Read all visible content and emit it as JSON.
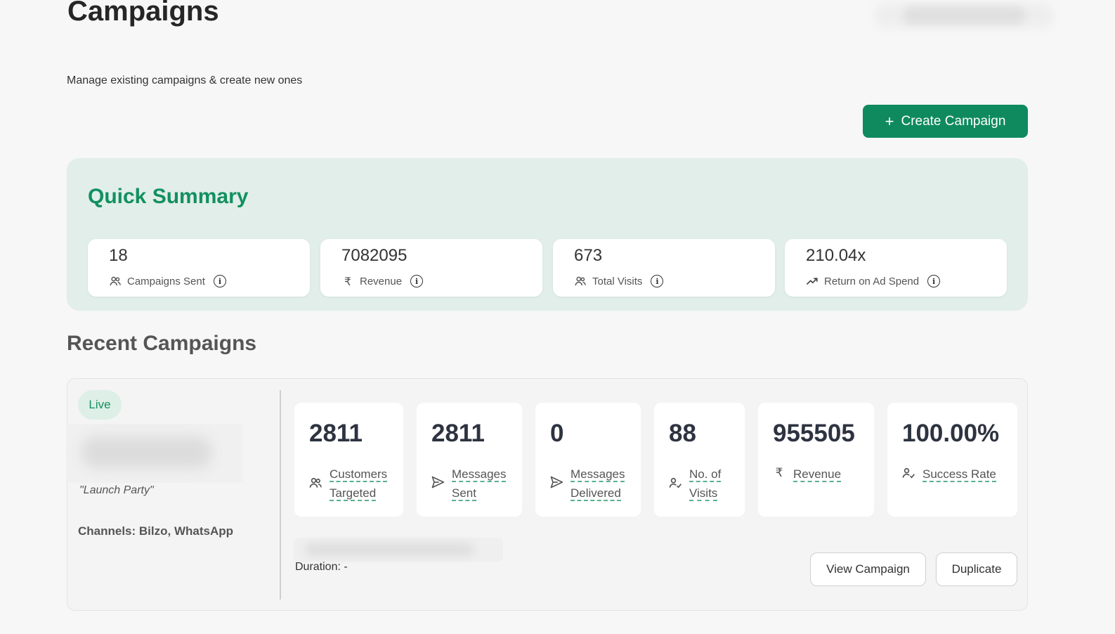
{
  "header": {
    "title": "Campaigns",
    "subtitle": "Manage existing campaigns & create new ones",
    "create_button_label": "Create Campaign"
  },
  "summary": {
    "title": "Quick Summary",
    "stats": [
      {
        "value": "18",
        "label": "Campaigns Sent",
        "icon": "users-icon"
      },
      {
        "value": "7082095",
        "label": "Revenue",
        "icon": "rupee-icon"
      },
      {
        "value": "673",
        "label": "Total Visits",
        "icon": "users-icon"
      },
      {
        "value": "210.04x",
        "label": "Return on Ad Spend",
        "icon": "trending-up-icon"
      }
    ]
  },
  "recent": {
    "title": "Recent Campaigns",
    "campaign": {
      "status": "Live",
      "tagline": "\"Launch Party\"",
      "channels": "Channels: Bilzo, WhatsApp",
      "duration": "Duration: -",
      "metrics": [
        {
          "value": "2811",
          "label_line1": "Customers",
          "label_line2": "Targeted",
          "icon": "users-icon"
        },
        {
          "value": "2811",
          "label_line1": "Messages",
          "label_line2": "Sent",
          "icon": "send-icon"
        },
        {
          "value": "0",
          "label_line1": "Messages",
          "label_line2": "Delivered",
          "icon": "send-icon"
        },
        {
          "value": "88",
          "label_line1": "No. of",
          "label_line2": "Visits",
          "icon": "user-check-icon"
        },
        {
          "value": "955505",
          "label_line1": "Revenue",
          "label_line2": "",
          "icon": "rupee-icon"
        },
        {
          "value": "100.00%",
          "label_line1": "Success Rate",
          "label_line2": "",
          "icon": "user-check-icon"
        }
      ],
      "view_button_label": "View Campaign",
      "duplicate_button_label": "Duplicate"
    }
  },
  "colors": {
    "accent": "#0f8a5f",
    "summary_bg": "#e1eeea",
    "live_badge_bg": "#ddefe6",
    "underline": "#5ab08d"
  }
}
